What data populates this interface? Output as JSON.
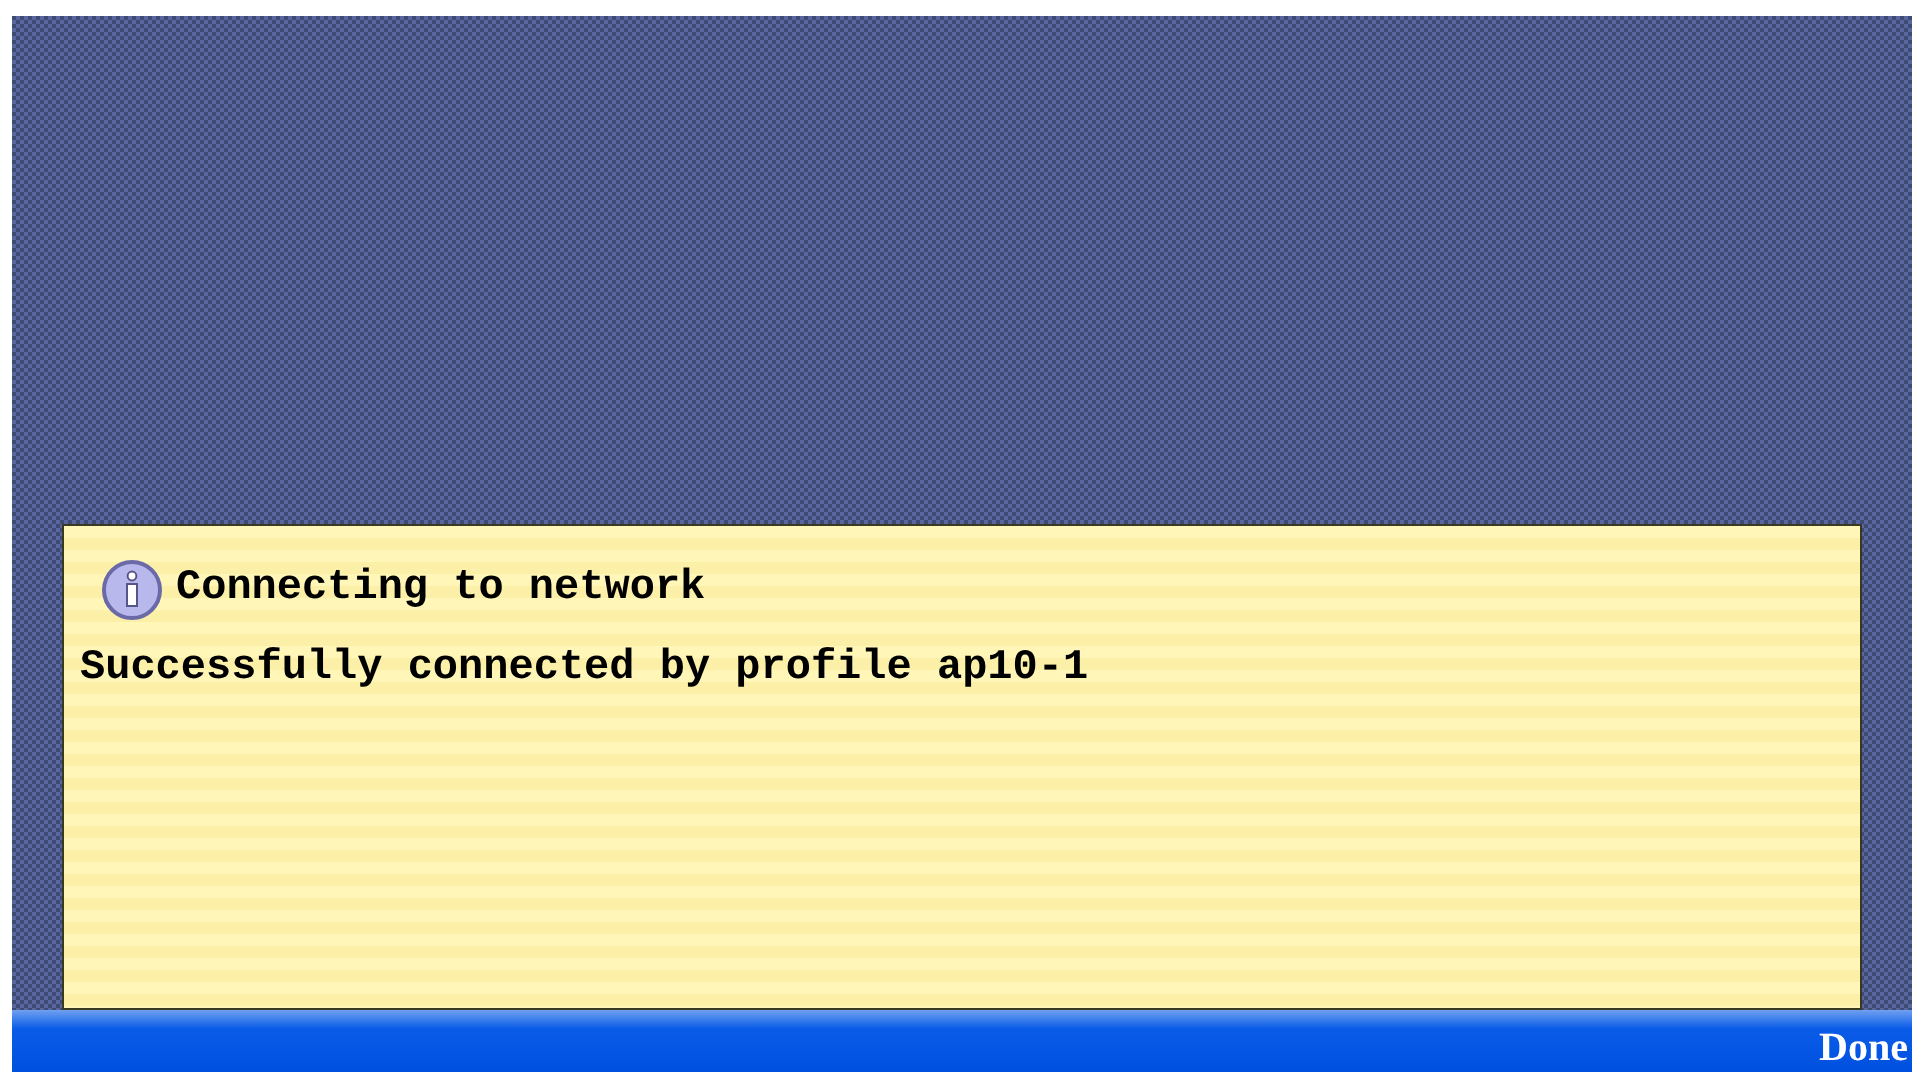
{
  "dialog": {
    "title": "Connecting to network",
    "message": "Successfully connected by profile ap10-1"
  },
  "softkey_bar": {
    "right_label": "Done"
  }
}
